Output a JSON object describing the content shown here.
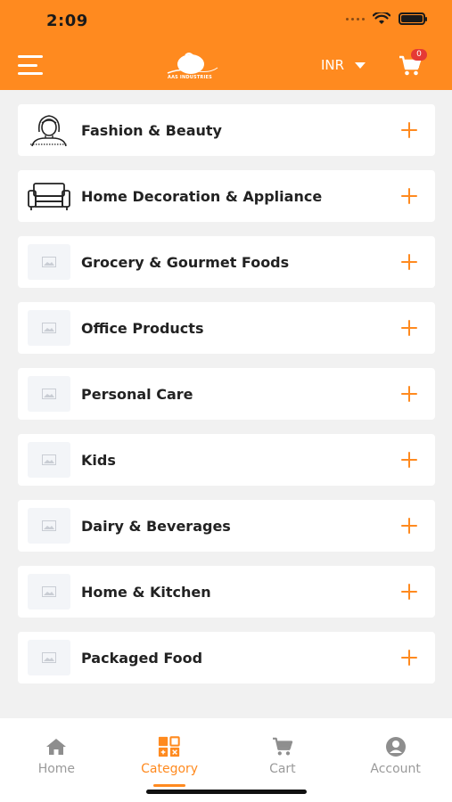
{
  "status_bar": {
    "time": "2:09"
  },
  "header": {
    "logo_text": "AAS INDUSTRIES",
    "currency": "INR",
    "cart_count": "0"
  },
  "categories": [
    {
      "label": "Fashion & Beauty",
      "icon": "woman-portrait-icon"
    },
    {
      "label": "Home Decoration & Appliance",
      "icon": "sofa-icon"
    },
    {
      "label": "Grocery & Gourmet Foods",
      "icon": "image-placeholder-icon"
    },
    {
      "label": "Office Products",
      "icon": "image-placeholder-icon"
    },
    {
      "label": "Personal Care",
      "icon": "image-placeholder-icon"
    },
    {
      "label": "Kids",
      "icon": "image-placeholder-icon"
    },
    {
      "label": "Dairy & Beverages",
      "icon": "image-placeholder-icon"
    },
    {
      "label": "Home & Kitchen",
      "icon": "image-placeholder-icon"
    },
    {
      "label": "Packaged Food",
      "icon": "image-placeholder-icon"
    }
  ],
  "bottom_nav": {
    "items": [
      {
        "label": "Home",
        "icon": "home-icon"
      },
      {
        "label": "Category",
        "icon": "category-icon",
        "active": true
      },
      {
        "label": "Cart",
        "icon": "cart-icon"
      },
      {
        "label": "Account",
        "icon": "account-icon"
      }
    ]
  },
  "colors": {
    "accent": "#ff8a1f",
    "badge": "#e53935",
    "background": "#f1f1f1",
    "inactive": "#9a9a9a"
  }
}
